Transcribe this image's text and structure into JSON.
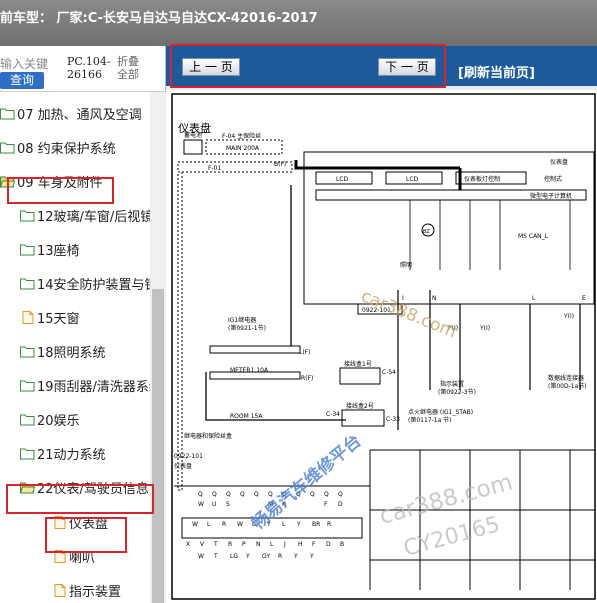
{
  "title": "前车型： 厂家:C-长安马自达马自达CX-42016-2017",
  "search": {
    "placeholder": "输入关键",
    "button": "查询"
  },
  "pc_code": [
    "PC.104-",
    "26166"
  ],
  "fold_label": [
    "折叠",
    "全部"
  ],
  "tree": [
    {
      "label": "07 加热、通风及空调",
      "type": "folder"
    },
    {
      "label": "08 约束保护系统",
      "type": "folder"
    },
    {
      "label": "09 车身及附件",
      "type": "folder-open"
    },
    {
      "label": "12玻璃/车窗/后视镜",
      "type": "folder"
    },
    {
      "label": "13座椅",
      "type": "folder"
    },
    {
      "label": "14安全防护装置与锁",
      "type": "folder"
    },
    {
      "label": "15天窗",
      "type": "doc"
    },
    {
      "label": "18照明系统",
      "type": "folder"
    },
    {
      "label": "19雨刮器/清洗器系统",
      "type": "folder"
    },
    {
      "label": "20娱乐",
      "type": "folder"
    },
    {
      "label": "21动力系统",
      "type": "folder"
    },
    {
      "label": "22仪表/驾驶员信息",
      "type": "folder-open"
    },
    {
      "label": "仪表盘",
      "type": "doc"
    },
    {
      "label": "喇叭",
      "type": "doc"
    },
    {
      "label": "指示装置",
      "type": "doc"
    }
  ],
  "toolbar": {
    "prev": "上 一 页",
    "next": "下 一 页",
    "refresh": "[刷新当前页]"
  },
  "diagram": {
    "heading": "仪表盘",
    "battery": "蓄电池",
    "fuse_box": "F-04 主保险丝",
    "main_fuse": "MAIN 200A",
    "f01": "F-01",
    "bf": "B(F)",
    "ig1_relay": "IG1继电器",
    "ig1_ref": "(第0921-1节)",
    "meter_fuse": "METER1 10A",
    "room_fuse": "ROOM 15A",
    "relay_box": "继电器和保险丝盒",
    "lf": "L(F)",
    "rf": "R(F)",
    "jb1": "接线盒1号",
    "jb2": "接线盒2号",
    "c54": "C-54",
    "c34": "C-34",
    "c33": "C-33",
    "conn_code": "0922-101",
    "cluster": "仪表盘",
    "lcd1": "LCD",
    "lcd2": "LCD",
    "panel_ctrl": "仪表板灯控制",
    "ctrl2": "控制式",
    "micro": "微型电子计算机",
    "bz": "BZ",
    "lighting": "照明",
    "ms_can": "MS CAN_L",
    "pins": [
      "I",
      "N",
      "L",
      "E"
    ],
    "pi": "P(I)",
    "yi": "Y(I)",
    "yi2": "Y(I)",
    "indicator": "指示装置",
    "indicator_ref": "(第0922-3节)",
    "data_link": "数据线连接器",
    "data_link_ref": "(第00D-1a节)",
    "ig_relay2": "点火继电器 (IG1_STAB)",
    "ig_relay2_ref": "(第0117-1a 节)",
    "bottom_code": "0922-101",
    "bottom_label": "仪表盘",
    "pin_top": [
      "Q",
      "Q",
      "Q",
      "Q",
      "Q",
      "Q",
      "Q",
      "Q",
      "Q",
      "Q",
      "Q"
    ],
    "pin_row2": [
      "W",
      "U",
      "S",
      "",
      "",
      "M",
      "K",
      "",
      "",
      "F",
      "D"
    ],
    "pin_row3": [
      "W",
      "L",
      "R",
      "W",
      "L",
      "Y",
      "L",
      "Y",
      "BR",
      "R"
    ],
    "pin_row4": [
      "X",
      "V",
      "T",
      "R",
      "P",
      "N",
      "L",
      "J",
      "H",
      "F",
      "D",
      "B"
    ],
    "pin_row5": [
      "W",
      "T",
      "LG",
      "Y",
      "GY",
      "R",
      "Y",
      "Y"
    ]
  },
  "watermarks": [
    "car388.com",
    "畅易汽车维修平台",
    "car388.com",
    "CY20165"
  ],
  "colors": {
    "titlebar": "#7a7a7a",
    "toolbar": "#1c5a9c",
    "highlight": "#d8242b",
    "folder": "#e9c766",
    "query": "#2e6fc3"
  }
}
